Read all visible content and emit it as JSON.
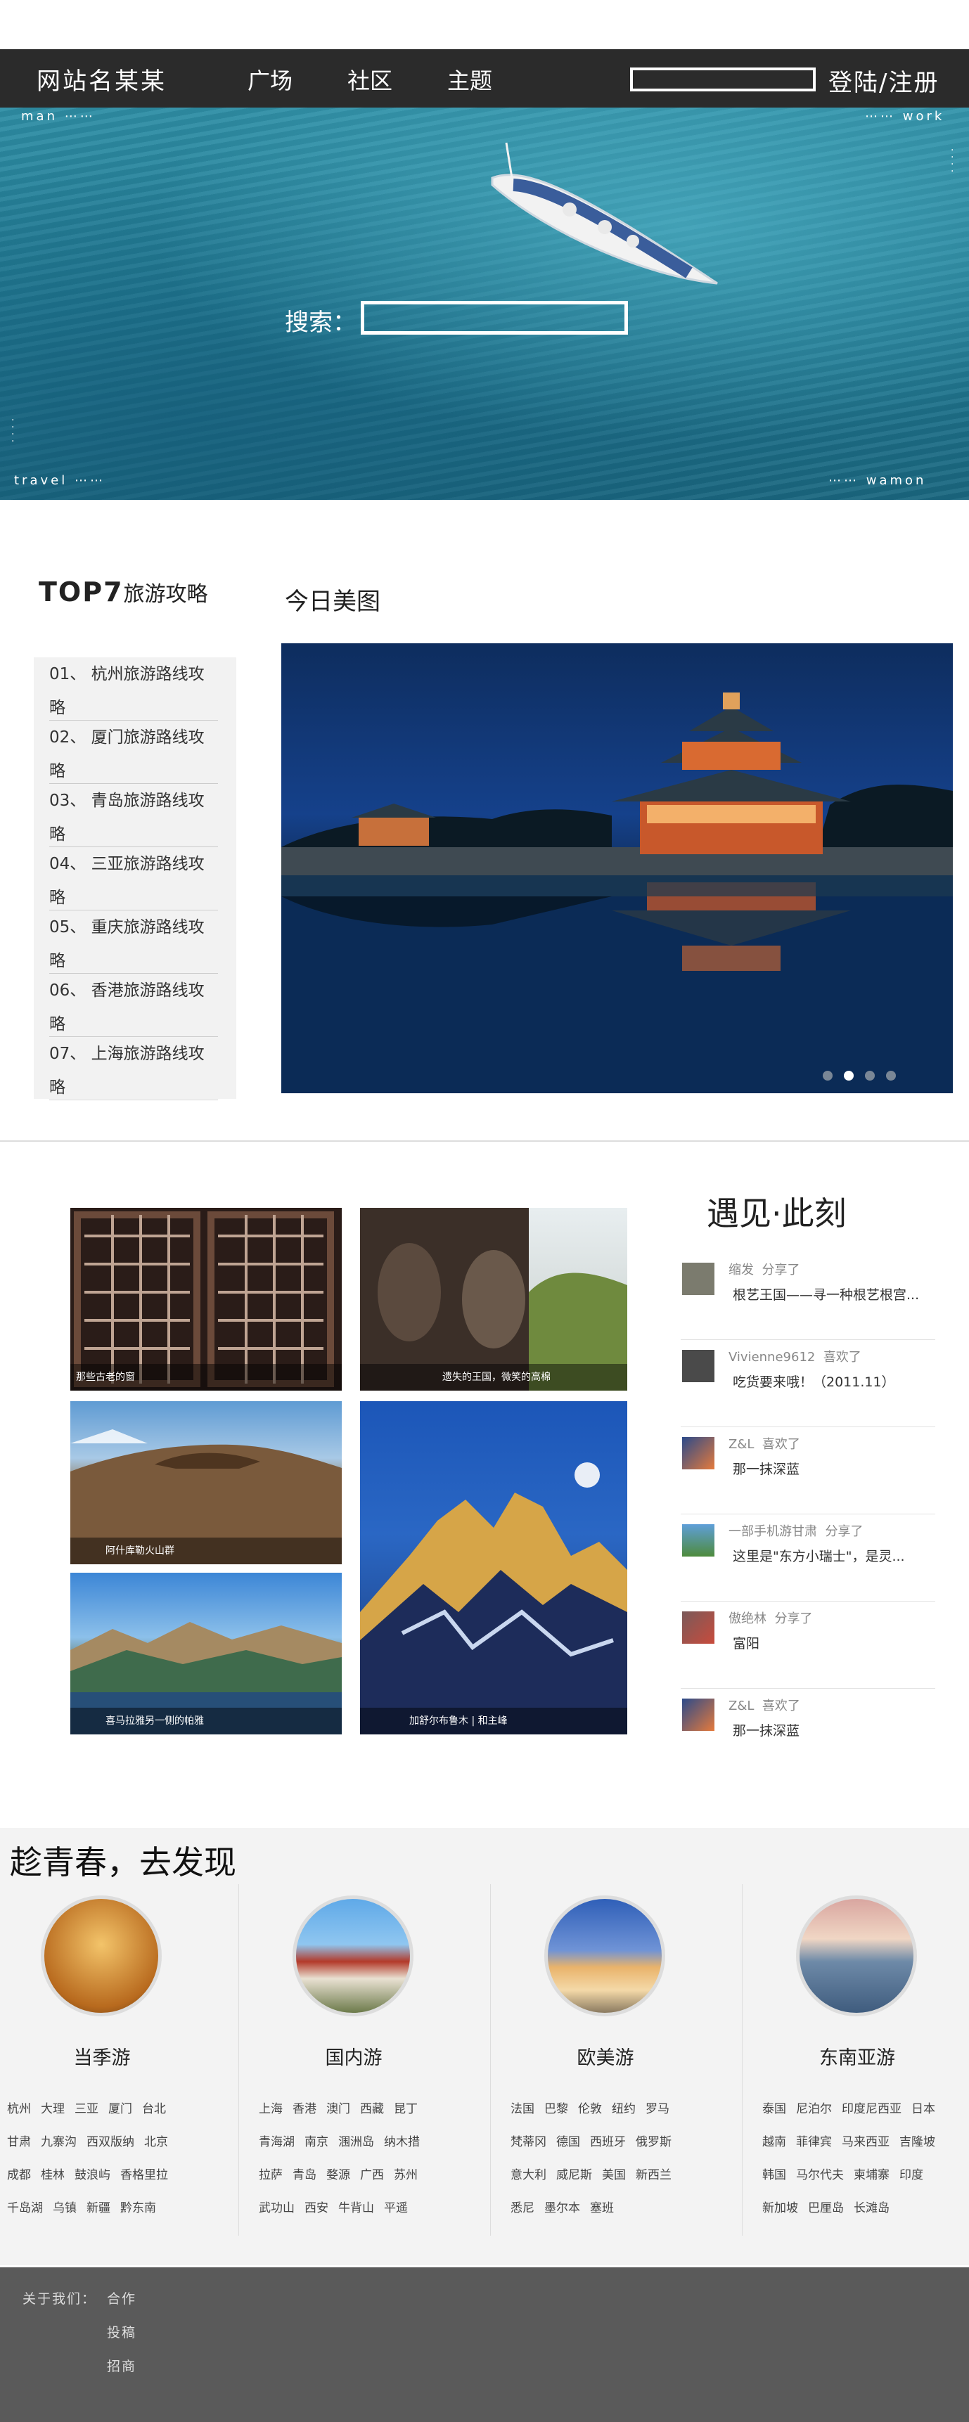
{
  "nav": {
    "logo": "网站名某某",
    "menu": [
      "广场",
      "社区",
      "主题"
    ],
    "login": "登陆/注册"
  },
  "hero": {
    "corner_tl": "man ⋯⋯",
    "corner_tr": "⋯⋯ work",
    "corner_bl": "travel ⋯⋯",
    "corner_br": "⋯⋯ wamon",
    "search_label": "搜索："
  },
  "top7": {
    "title_big": "TOP7",
    "title_small": "旅游攻略",
    "items": [
      "01、 杭州旅游路线攻略",
      "02、 厦门旅游路线攻略",
      "03、 青岛旅游路线攻略",
      "04、 三亚旅游路线攻略",
      "05、 重庆旅游路线攻略",
      "06、 香港旅游路线攻略",
      "07、 上海旅游路线攻略"
    ]
  },
  "today": {
    "title": "今日美图",
    "carousel_active_index": 1,
    "carousel_count": 4
  },
  "photos": {
    "captions": [
      "那些古老的窗",
      "遗失的王国，微笑的高棉",
      "阿什库勒火山群",
      "加舒尔布鲁木 | 和主峰",
      "喜马拉雅另一侧的帕雅"
    ]
  },
  "meet": {
    "title": "遇见·此刻",
    "feed": [
      {
        "user": "缩发",
        "action": "分享了",
        "text": "根艺王国——寻一种根艺根宫..."
      },
      {
        "user": "Vivienne9612",
        "action": "喜欢了",
        "text": "吃货要来哦！（2011.11）"
      },
      {
        "user": "Z&L",
        "action": "喜欢了",
        "text": "那一抹深蓝"
      },
      {
        "user": "一部手机游甘肃",
        "action": "分享了",
        "text": "这里是\"东方小瑞士\"，是灵..."
      },
      {
        "user": "傲绝林",
        "action": "分享了",
        "text": "富阳"
      },
      {
        "user": "Z&L",
        "action": "喜欢了",
        "text": "那一抹深蓝"
      }
    ]
  },
  "discover": {
    "title": "趁青春，去发现",
    "columns": [
      {
        "title": "当季游",
        "rows": [
          [
            "杭州",
            "大理",
            "三亚",
            "厦门",
            "台北"
          ],
          [
            "甘肃",
            "九寨沟",
            "西双版纳",
            "北京"
          ],
          [
            "成都",
            "桂林",
            "鼓浪屿",
            "香格里拉"
          ],
          [
            "千岛湖",
            "乌镇",
            "新疆",
            "黔东南"
          ]
        ]
      },
      {
        "title": "国内游",
        "rows": [
          [
            "上海",
            "香港",
            "澳门",
            "西藏",
            "昆丁"
          ],
          [
            "青海湖",
            "南京",
            "涠洲岛",
            "纳木措"
          ],
          [
            "拉萨",
            "青岛",
            "婺源",
            "广西",
            "苏州"
          ],
          [
            "武功山",
            "西安",
            "牛背山",
            "平遥"
          ]
        ]
      },
      {
        "title": "欧美游",
        "rows": [
          [
            "法国",
            "巴黎",
            "伦敦",
            "纽约",
            "罗马"
          ],
          [
            "梵蒂冈",
            "德国",
            "西班牙",
            "俄罗斯"
          ],
          [
            "意大利",
            "威尼斯",
            "美国",
            "新西兰"
          ],
          [
            "悉尼",
            "墨尔本",
            "塞班"
          ]
        ]
      },
      {
        "title": "东南亚游",
        "rows": [
          [
            "泰国",
            "尼泊尔",
            "印度尼西亚",
            "日本"
          ],
          [
            "越南",
            "菲律宾",
            "马来西亚",
            "吉隆坡"
          ],
          [
            "韩国",
            "马尔代夫",
            "柬埔寨",
            "印度"
          ],
          [
            "新加坡",
            "巴厘岛",
            "长滩岛"
          ]
        ]
      }
    ]
  },
  "footer": {
    "about": "关于我们：",
    "links": [
      "合作",
      "投稿",
      "招商"
    ]
  }
}
